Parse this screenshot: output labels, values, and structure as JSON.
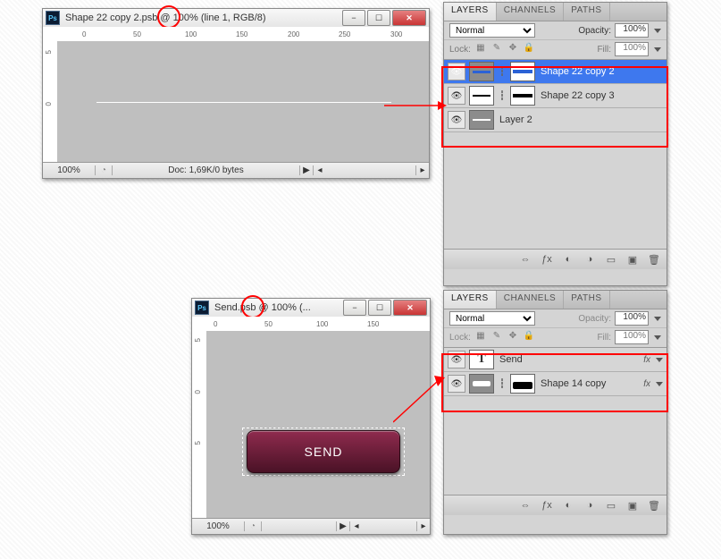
{
  "win1": {
    "title": "Shape 22 copy 2.psb @ 100% (line 1, RGB/8)",
    "zoom": "100%",
    "docinfo": "Doc: 1,69K/0 bytes",
    "ruler_h": [
      "0",
      "50",
      "100",
      "150",
      "200",
      "250",
      "300"
    ],
    "ruler_v": [
      "5",
      "0"
    ]
  },
  "win2": {
    "title": "Send.psb @ 100% (...",
    "zoom": "100%",
    "ruler_h": [
      "0",
      "50",
      "100",
      "150"
    ],
    "ruler_v": [
      "5",
      "0",
      "5"
    ],
    "button_text": "SEND"
  },
  "panel1": {
    "tabs": [
      "LAYERS",
      "CHANNELS",
      "PATHS"
    ],
    "blend": "Normal",
    "opacity_label": "Opacity:",
    "opacity_val": "100%",
    "lock_label": "Lock:",
    "fill_label": "Fill:",
    "fill_val": "100%",
    "layers": [
      {
        "name": "Shape 22 copy 2",
        "sel": true
      },
      {
        "name": "Shape 22 copy 3"
      },
      {
        "name": "Layer 2"
      }
    ]
  },
  "panel2": {
    "tabs": [
      "LAYERS",
      "CHANNELS",
      "PATHS"
    ],
    "blend": "Normal",
    "opacity_label": "Opacity:",
    "opacity_val": "100%",
    "lock_label": "Lock:",
    "fill_label": "Fill:",
    "fill_val": "100%",
    "layers": [
      {
        "name": "Send",
        "fx": "fx"
      },
      {
        "name": "Shape 14 copy",
        "fx": "fx"
      }
    ]
  }
}
